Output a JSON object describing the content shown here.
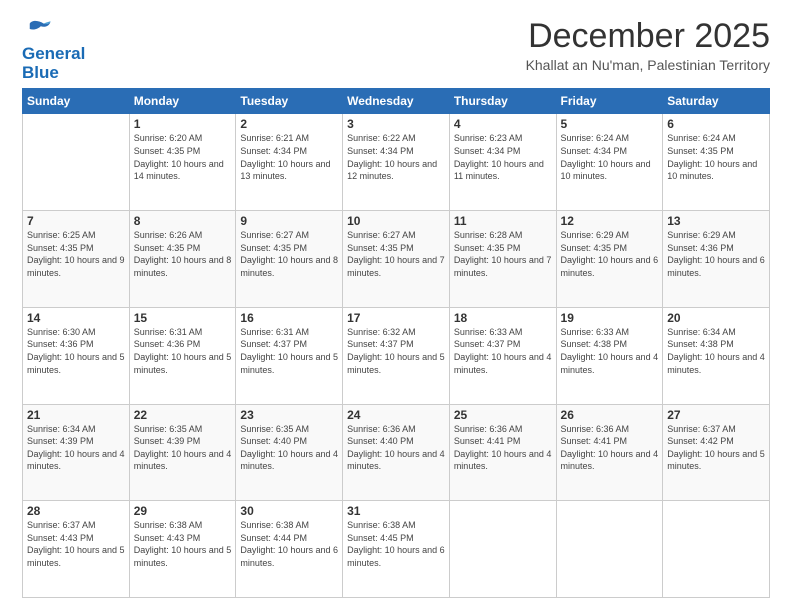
{
  "header": {
    "logo_line1": "General",
    "logo_line2": "Blue",
    "title": "December 2025",
    "subtitle": "Khallat an Nu'man, Palestinian Territory"
  },
  "weekdays": [
    "Sunday",
    "Monday",
    "Tuesday",
    "Wednesday",
    "Thursday",
    "Friday",
    "Saturday"
  ],
  "weeks": [
    [
      {
        "day": "",
        "info": ""
      },
      {
        "day": "1",
        "info": "Sunrise: 6:20 AM\nSunset: 4:35 PM\nDaylight: 10 hours\nand 14 minutes."
      },
      {
        "day": "2",
        "info": "Sunrise: 6:21 AM\nSunset: 4:34 PM\nDaylight: 10 hours\nand 13 minutes."
      },
      {
        "day": "3",
        "info": "Sunrise: 6:22 AM\nSunset: 4:34 PM\nDaylight: 10 hours\nand 12 minutes."
      },
      {
        "day": "4",
        "info": "Sunrise: 6:23 AM\nSunset: 4:34 PM\nDaylight: 10 hours\nand 11 minutes."
      },
      {
        "day": "5",
        "info": "Sunrise: 6:24 AM\nSunset: 4:34 PM\nDaylight: 10 hours\nand 10 minutes."
      },
      {
        "day": "6",
        "info": "Sunrise: 6:24 AM\nSunset: 4:35 PM\nDaylight: 10 hours\nand 10 minutes."
      }
    ],
    [
      {
        "day": "7",
        "info": "Sunrise: 6:25 AM\nSunset: 4:35 PM\nDaylight: 10 hours\nand 9 minutes."
      },
      {
        "day": "8",
        "info": "Sunrise: 6:26 AM\nSunset: 4:35 PM\nDaylight: 10 hours\nand 8 minutes."
      },
      {
        "day": "9",
        "info": "Sunrise: 6:27 AM\nSunset: 4:35 PM\nDaylight: 10 hours\nand 8 minutes."
      },
      {
        "day": "10",
        "info": "Sunrise: 6:27 AM\nSunset: 4:35 PM\nDaylight: 10 hours\nand 7 minutes."
      },
      {
        "day": "11",
        "info": "Sunrise: 6:28 AM\nSunset: 4:35 PM\nDaylight: 10 hours\nand 7 minutes."
      },
      {
        "day": "12",
        "info": "Sunrise: 6:29 AM\nSunset: 4:35 PM\nDaylight: 10 hours\nand 6 minutes."
      },
      {
        "day": "13",
        "info": "Sunrise: 6:29 AM\nSunset: 4:36 PM\nDaylight: 10 hours\nand 6 minutes."
      }
    ],
    [
      {
        "day": "14",
        "info": "Sunrise: 6:30 AM\nSunset: 4:36 PM\nDaylight: 10 hours\nand 5 minutes."
      },
      {
        "day": "15",
        "info": "Sunrise: 6:31 AM\nSunset: 4:36 PM\nDaylight: 10 hours\nand 5 minutes."
      },
      {
        "day": "16",
        "info": "Sunrise: 6:31 AM\nSunset: 4:37 PM\nDaylight: 10 hours\nand 5 minutes."
      },
      {
        "day": "17",
        "info": "Sunrise: 6:32 AM\nSunset: 4:37 PM\nDaylight: 10 hours\nand 5 minutes."
      },
      {
        "day": "18",
        "info": "Sunrise: 6:33 AM\nSunset: 4:37 PM\nDaylight: 10 hours\nand 4 minutes."
      },
      {
        "day": "19",
        "info": "Sunrise: 6:33 AM\nSunset: 4:38 PM\nDaylight: 10 hours\nand 4 minutes."
      },
      {
        "day": "20",
        "info": "Sunrise: 6:34 AM\nSunset: 4:38 PM\nDaylight: 10 hours\nand 4 minutes."
      }
    ],
    [
      {
        "day": "21",
        "info": "Sunrise: 6:34 AM\nSunset: 4:39 PM\nDaylight: 10 hours\nand 4 minutes."
      },
      {
        "day": "22",
        "info": "Sunrise: 6:35 AM\nSunset: 4:39 PM\nDaylight: 10 hours\nand 4 minutes."
      },
      {
        "day": "23",
        "info": "Sunrise: 6:35 AM\nSunset: 4:40 PM\nDaylight: 10 hours\nand 4 minutes."
      },
      {
        "day": "24",
        "info": "Sunrise: 6:36 AM\nSunset: 4:40 PM\nDaylight: 10 hours\nand 4 minutes."
      },
      {
        "day": "25",
        "info": "Sunrise: 6:36 AM\nSunset: 4:41 PM\nDaylight: 10 hours\nand 4 minutes."
      },
      {
        "day": "26",
        "info": "Sunrise: 6:36 AM\nSunset: 4:41 PM\nDaylight: 10 hours\nand 4 minutes."
      },
      {
        "day": "27",
        "info": "Sunrise: 6:37 AM\nSunset: 4:42 PM\nDaylight: 10 hours\nand 5 minutes."
      }
    ],
    [
      {
        "day": "28",
        "info": "Sunrise: 6:37 AM\nSunset: 4:43 PM\nDaylight: 10 hours\nand 5 minutes."
      },
      {
        "day": "29",
        "info": "Sunrise: 6:38 AM\nSunset: 4:43 PM\nDaylight: 10 hours\nand 5 minutes."
      },
      {
        "day": "30",
        "info": "Sunrise: 6:38 AM\nSunset: 4:44 PM\nDaylight: 10 hours\nand 6 minutes."
      },
      {
        "day": "31",
        "info": "Sunrise: 6:38 AM\nSunset: 4:45 PM\nDaylight: 10 hours\nand 6 minutes."
      },
      {
        "day": "",
        "info": ""
      },
      {
        "day": "",
        "info": ""
      },
      {
        "day": "",
        "info": ""
      }
    ]
  ]
}
